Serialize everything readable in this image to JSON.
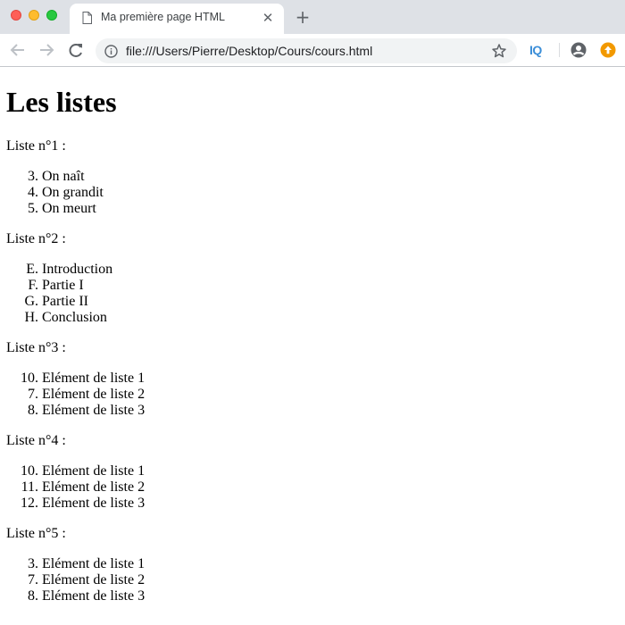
{
  "browser": {
    "tab_title": "Ma première page HTML",
    "tab_close": "✕",
    "new_tab": "+",
    "url": "file:///Users/Pierre/Desktop/Cours/cours.html",
    "extension_label": "IQ"
  },
  "page": {
    "heading": "Les listes",
    "lists": [
      {
        "label": "Liste n°1 :",
        "items": [
          {
            "marker": "3.",
            "text": "On naît"
          },
          {
            "marker": "4.",
            "text": "On grandit"
          },
          {
            "marker": "5.",
            "text": "On meurt"
          }
        ]
      },
      {
        "label": "Liste n°2 :",
        "items": [
          {
            "marker": "E.",
            "text": "Introduction"
          },
          {
            "marker": "F.",
            "text": "Partie I"
          },
          {
            "marker": "G.",
            "text": "Partie II"
          },
          {
            "marker": "H.",
            "text": "Conclusion"
          }
        ]
      },
      {
        "label": "Liste n°3 :",
        "items": [
          {
            "marker": "10.",
            "text": "Elément de liste 1"
          },
          {
            "marker": "7.",
            "text": "Elément de liste 2"
          },
          {
            "marker": "8.",
            "text": "Elément de liste 3"
          }
        ]
      },
      {
        "label": "Liste n°4 :",
        "items": [
          {
            "marker": "10.",
            "text": "Elément de liste 1"
          },
          {
            "marker": "11.",
            "text": "Elément de liste 2"
          },
          {
            "marker": "12.",
            "text": "Elément de liste 3"
          }
        ]
      },
      {
        "label": "Liste n°5 :",
        "items": [
          {
            "marker": "3.",
            "text": "Elément de liste 1"
          },
          {
            "marker": "7.",
            "text": "Elément de liste 2"
          },
          {
            "marker": "8.",
            "text": "Elément de liste 3"
          }
        ]
      }
    ]
  }
}
